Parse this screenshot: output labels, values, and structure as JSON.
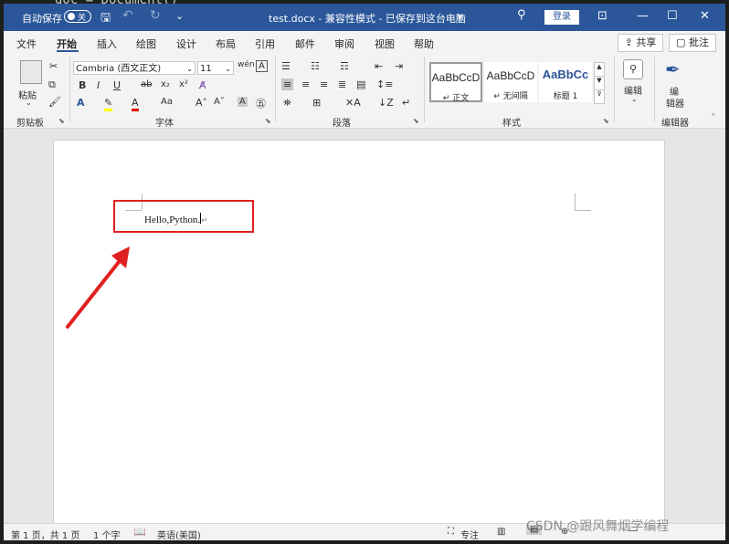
{
  "background_code": "doc = Document()",
  "titlebar": {
    "autosave_label": "自动保存",
    "autosave_state": "关",
    "title": "test.docx  -  兼容性模式  -  已保存到这台电脑",
    "login_label": "登录"
  },
  "tabs": [
    "文件",
    "开始",
    "插入",
    "绘图",
    "设计",
    "布局",
    "引用",
    "邮件",
    "审阅",
    "视图",
    "帮助"
  ],
  "share_label": "共享",
  "comment_label": "批注",
  "ribbon": {
    "clipboard": {
      "paste": "粘贴",
      "group": "剪贴板"
    },
    "font": {
      "name": "Cambria (西文正文)",
      "size": "11",
      "group": "字体"
    },
    "paragraph": {
      "group": "段落"
    },
    "styles": {
      "group": "样式",
      "items": [
        {
          "sample": "AaBbCcD",
          "name": "↵ 正文"
        },
        {
          "sample": "AaBbCcD",
          "name": "↵ 无间隔"
        },
        {
          "sample": "AaBbCc",
          "name": "标题 1"
        }
      ]
    },
    "editing": {
      "label": "编辑"
    },
    "editor": {
      "label1": "编",
      "label2": "辑器",
      "group": "编辑器"
    }
  },
  "document": {
    "text": "Hello,Python.",
    "para_mark": "↵"
  },
  "statusbar": {
    "page": "第 1 页，共 1 页",
    "words": "1 个字",
    "language": "英语(美国)",
    "focus": "专注"
  },
  "watermark": "CSDN @跟风舞烟学编程",
  "colors": {
    "titlebar": "#2b579a",
    "highlight_box": "#e02020",
    "arrow": "#e02020"
  }
}
